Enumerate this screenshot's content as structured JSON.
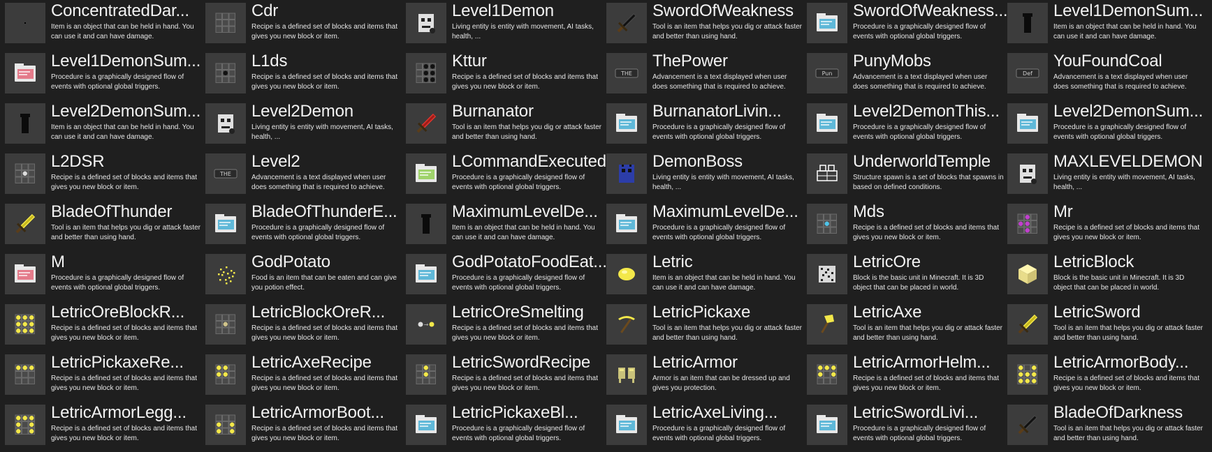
{
  "element_types": {
    "item": "Item is an object that can be held in hand. You can use it and can have damage.",
    "recipe": "Recipe is a defined set of blocks and items that gives you new block or item.",
    "entity": "Living entity is entity with movement, AI tasks, health, ...",
    "tool": "Tool is an item that helps you dig or attack faster and better than using hand.",
    "procedure": "Procedure is a graphically designed flow of events with optional global triggers.",
    "advancement": "Advancement is a text displayed when user does something that is required to achieve.",
    "structure": "Structure spawn is a set of blocks that spawns in based on defined conditions.",
    "food": "Food is an item that can be eaten and can give you potion effect.",
    "block": "Block is the basic unit in Minecraft. It is 3D object that can be placed in world.",
    "armor": "Armor is an item that can be dressed up and gives you protection."
  },
  "colors": {
    "background": "#1f1f1f",
    "tile_icon_bg": "#3c3c3c",
    "text": "#f2f2f2",
    "letric_yellow": "#f3e84a",
    "procedure_blue": "#5fb8d8"
  },
  "elements": [
    {
      "name": "ConcentratedDar...",
      "type": "item",
      "icon": "dot-icon"
    },
    {
      "name": "Cdr",
      "type": "recipe",
      "icon": "recipe-grid-empty-icon"
    },
    {
      "name": "Level1Demon",
      "type": "entity",
      "icon": "demon-face-icon"
    },
    {
      "name": "SwordOfWeakness",
      "type": "tool",
      "icon": "dark-sword-icon"
    },
    {
      "name": "SwordOfWeakness...",
      "type": "procedure",
      "icon": "procedure-folder-icon"
    },
    {
      "name": "Level1DemonSum...",
      "type": "item",
      "icon": "black-pillar-icon"
    },
    {
      "name": "Level1DemonSum...",
      "type": "procedure",
      "icon": "procedure-folder-pink-icon"
    },
    {
      "name": "L1ds",
      "type": "recipe",
      "icon": "recipe-grid-dot-icon"
    },
    {
      "name": "Kttur",
      "type": "recipe",
      "icon": "recipe-grid-black-icon"
    },
    {
      "name": "ThePower",
      "type": "advancement",
      "icon": "advancement-badge-icon",
      "badge": "THE"
    },
    {
      "name": "PunyMobs",
      "type": "advancement",
      "icon": "advancement-badge-icon",
      "badge": "Pun"
    },
    {
      "name": "YouFoundCoal",
      "type": "advancement",
      "icon": "advancement-badge-icon",
      "badge": "Def"
    },
    {
      "name": "Level2DemonSum...",
      "type": "item",
      "icon": "black-pillar-icon"
    },
    {
      "name": "Level2Demon",
      "type": "entity",
      "icon": "demon-face-icon"
    },
    {
      "name": "Burnanator",
      "type": "tool",
      "icon": "red-sword-icon"
    },
    {
      "name": "BurnanatorLivin...",
      "type": "procedure",
      "icon": "procedure-folder-icon"
    },
    {
      "name": "Level2DemonThis...",
      "type": "procedure",
      "icon": "procedure-folder-icon"
    },
    {
      "name": "Level2DemonSum...",
      "type": "procedure",
      "icon": "procedure-folder-icon"
    },
    {
      "name": "L2DSR",
      "type": "recipe",
      "icon": "recipe-grid-item-icon"
    },
    {
      "name": "Level2",
      "type": "advancement",
      "icon": "advancement-badge-icon",
      "badge": "THE"
    },
    {
      "name": "LCommandExecuted",
      "type": "procedure",
      "icon": "procedure-folder-green-icon"
    },
    {
      "name": "DemonBoss",
      "type": "entity",
      "icon": "blue-demon-icon"
    },
    {
      "name": "UnderworldTemple",
      "type": "structure",
      "icon": "structure-icon"
    },
    {
      "name": "MAXLEVELDEMON",
      "type": "entity",
      "icon": "demon-face-icon"
    },
    {
      "name": "BladeOfThunder",
      "type": "tool",
      "icon": "yellow-sword-icon"
    },
    {
      "name": "BladeOfThunderE...",
      "type": "procedure",
      "icon": "procedure-folder-icon"
    },
    {
      "name": "MaximumLevelDe...",
      "type": "item",
      "icon": "black-pillar-icon"
    },
    {
      "name": "MaximumLevelDe...",
      "type": "procedure",
      "icon": "procedure-folder-icon"
    },
    {
      "name": "Mds",
      "type": "recipe",
      "icon": "recipe-grid-diamond-icon"
    },
    {
      "name": "Mr",
      "type": "recipe",
      "icon": "recipe-grid-purple-icon"
    },
    {
      "name": "M",
      "type": "procedure",
      "icon": "procedure-folder-pink-icon"
    },
    {
      "name": "GodPotato",
      "type": "food",
      "icon": "god-potato-icon"
    },
    {
      "name": "GodPotatoFoodEat...",
      "type": "procedure",
      "icon": "procedure-folder-icon"
    },
    {
      "name": "Letric",
      "type": "item",
      "icon": "letric-gem-icon"
    },
    {
      "name": "LetricOre",
      "type": "block",
      "icon": "ore-block-icon"
    },
    {
      "name": "LetricBlock",
      "type": "block",
      "icon": "letric-block-icon"
    },
    {
      "name": "LetricOreBlockR...",
      "type": "recipe",
      "icon": "recipe-grid-full-yellow-icon"
    },
    {
      "name": "LetricBlockOreR...",
      "type": "recipe",
      "icon": "recipe-grid-ore-icon"
    },
    {
      "name": "LetricOreSmelting",
      "type": "recipe",
      "icon": "smelting-icon"
    },
    {
      "name": "LetricPickaxe",
      "type": "tool",
      "icon": "pickaxe-icon"
    },
    {
      "name": "LetricAxe",
      "type": "tool",
      "icon": "axe-icon"
    },
    {
      "name": "LetricSword",
      "type": "tool",
      "icon": "yellow-sword-icon"
    },
    {
      "name": "LetricPickaxeRe...",
      "type": "recipe",
      "icon": "recipe-grid-pickaxe-icon"
    },
    {
      "name": "LetricAxeRecipe",
      "type": "recipe",
      "icon": "recipe-grid-axe-icon"
    },
    {
      "name": "LetricSwordRecipe",
      "type": "recipe",
      "icon": "recipe-grid-sword-icon"
    },
    {
      "name": "LetricArmor",
      "type": "armor",
      "icon": "armor-icon"
    },
    {
      "name": "LetricArmorHelm...",
      "type": "recipe",
      "icon": "recipe-grid-helmet-icon"
    },
    {
      "name": "LetricArmorBody...",
      "type": "recipe",
      "icon": "recipe-grid-body-icon"
    },
    {
      "name": "LetricArmorLegg...",
      "type": "recipe",
      "icon": "recipe-grid-legs-icon"
    },
    {
      "name": "LetricArmorBoot...",
      "type": "recipe",
      "icon": "recipe-grid-boots-icon"
    },
    {
      "name": "LetricPickaxeBl...",
      "type": "procedure",
      "icon": "procedure-folder-icon"
    },
    {
      "name": "LetricAxeLiving...",
      "type": "procedure",
      "icon": "procedure-folder-icon"
    },
    {
      "name": "LetricSwordLivi...",
      "type": "procedure",
      "icon": "procedure-folder-icon"
    },
    {
      "name": "BladeOfDarkness",
      "type": "tool",
      "icon": "dark-sword-icon"
    }
  ]
}
